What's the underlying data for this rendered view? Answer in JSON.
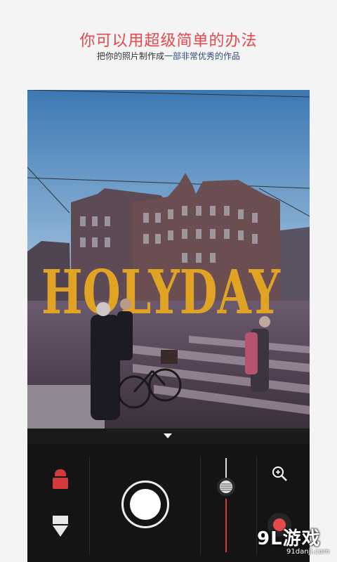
{
  "promo": {
    "title": "你可以用超级简单的办法",
    "subtitle_prefix": "把你的照片制作成",
    "subtitle_highlight": "一部非常优秀的作品"
  },
  "photo": {
    "overlay_text": "HOLYDAY",
    "overlay_color": "#e0a323"
  },
  "toolbar": {
    "left_tools": [
      "marker-icon",
      "eraser-icon"
    ],
    "shutter": "shutter-button",
    "slider": "vertical-slider",
    "zoom": "zoom-in-icon",
    "record": "record-button"
  },
  "colors": {
    "accent": "#e8474a",
    "highlight": "#2f4a7a",
    "panel": "#141414"
  },
  "watermark": {
    "logo": "9L游戏",
    "url": "91danji.com"
  }
}
